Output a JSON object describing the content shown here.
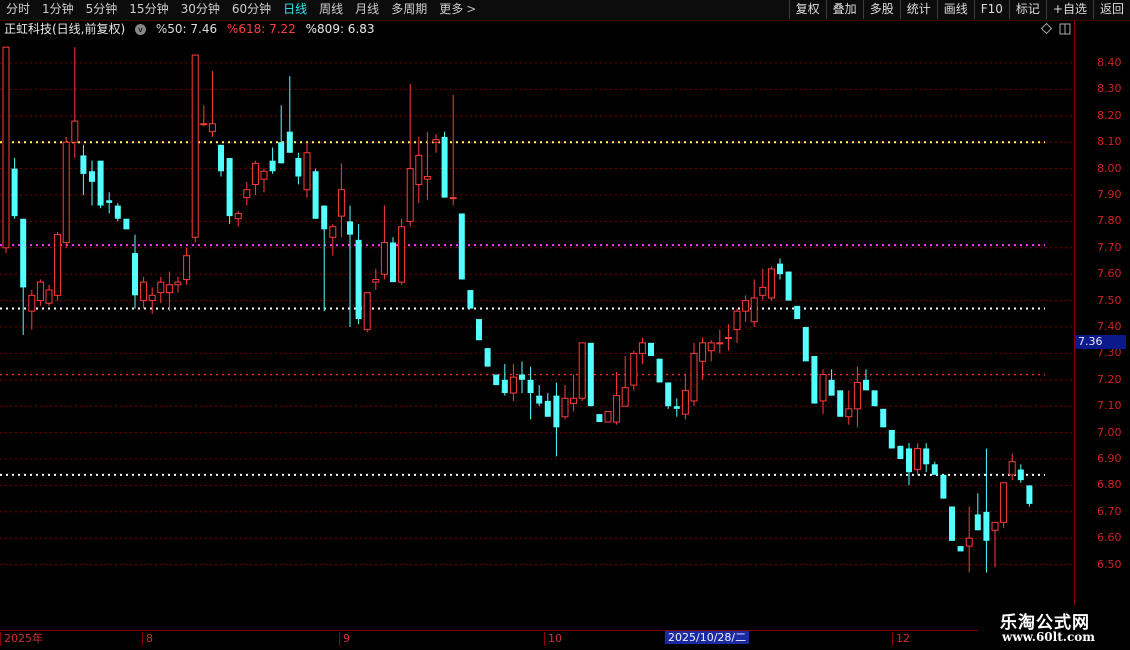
{
  "toolbar": {
    "tabs": [
      {
        "label": "分时",
        "active": false
      },
      {
        "label": "1分钟",
        "active": false
      },
      {
        "label": "5分钟",
        "active": false
      },
      {
        "label": "15分钟",
        "active": false
      },
      {
        "label": "30分钟",
        "active": false
      },
      {
        "label": "60分钟",
        "active": false
      },
      {
        "label": "日线",
        "active": true
      },
      {
        "label": "周线",
        "active": false
      },
      {
        "label": "月线",
        "active": false
      },
      {
        "label": "多周期",
        "active": false
      },
      {
        "label": "更多",
        "active": false
      }
    ],
    "right_buttons": [
      "复权",
      "叠加",
      "多股",
      "统计",
      "画线",
      "F10",
      "标记",
      "+自选",
      "返回"
    ]
  },
  "info": {
    "stock_name": "正虹科技(日线,前复权)",
    "ma50": "%50: 7.46",
    "ma618": "%618: 7.22",
    "ma809": "%809: 6.83"
  },
  "price_axis": {
    "labels": [
      "8.40",
      "8.30",
      "8.20",
      "8.10",
      "8.00",
      "7.90",
      "7.80",
      "7.70",
      "7.60",
      "7.50",
      "7.40",
      "7.30",
      "7.20",
      "7.10",
      "7.00",
      "6.90",
      "6.80",
      "6.70",
      "6.60",
      "6.50"
    ],
    "current_price": "7.36"
  },
  "time_axis": {
    "labels": [
      "2025年",
      "8",
      "9",
      "10",
      "12"
    ],
    "cursor_date": "2025/10/28/二"
  },
  "watermark": {
    "title": "乐淘公式网",
    "url": "www.60lt.com"
  },
  "colors": {
    "up": "#ff3b3b",
    "down": "#54ffff",
    "up_fill": "#000000",
    "level_yellow": "#ffff66",
    "level_magenta": "#ff33ff",
    "level_white": "#ffffff",
    "level_red": "#ff3030"
  },
  "chart_data": {
    "type": "candlestick",
    "y_range": [
      6.46,
      8.48
    ],
    "levels": [
      {
        "value": 8.1,
        "color": "yellow"
      },
      {
        "value": 7.71,
        "color": "magenta"
      },
      {
        "value": 7.47,
        "color": "white"
      },
      {
        "value": 7.22,
        "color": "red"
      },
      {
        "value": 6.84,
        "color": "white"
      }
    ],
    "candles": [
      [
        7.7,
        8.46,
        7.68,
        8.46
      ],
      [
        8.0,
        8.04,
        7.81,
        7.82
      ],
      [
        7.81,
        7.81,
        7.37,
        7.55
      ],
      [
        7.46,
        7.54,
        7.39,
        7.52
      ],
      [
        7.5,
        7.58,
        7.48,
        7.57
      ],
      [
        7.49,
        7.56,
        7.48,
        7.54
      ],
      [
        7.52,
        7.76,
        7.5,
        7.75
      ],
      [
        7.72,
        8.12,
        7.7,
        8.1
      ],
      [
        8.1,
        8.46,
        8.04,
        8.18
      ],
      [
        8.05,
        8.09,
        7.9,
        7.98
      ],
      [
        7.99,
        8.03,
        7.86,
        7.95
      ],
      [
        8.03,
        8.03,
        7.85,
        7.86
      ],
      [
        7.88,
        7.91,
        7.83,
        7.87
      ],
      [
        7.86,
        7.87,
        7.8,
        7.81
      ],
      [
        7.81,
        7.81,
        7.77,
        7.77
      ],
      [
        7.68,
        7.75,
        7.47,
        7.52
      ],
      [
        7.5,
        7.59,
        7.47,
        7.57
      ],
      [
        7.5,
        7.55,
        7.45,
        7.52
      ],
      [
        7.53,
        7.59,
        7.49,
        7.57
      ],
      [
        7.53,
        7.61,
        7.46,
        7.56
      ],
      [
        7.56,
        7.59,
        7.53,
        7.57
      ],
      [
        7.58,
        7.7,
        7.56,
        7.67
      ],
      [
        7.74,
        8.43,
        7.72,
        8.43
      ],
      [
        8.17,
        8.24,
        8.16,
        8.17
      ],
      [
        8.14,
        8.37,
        8.12,
        8.17
      ],
      [
        8.09,
        8.09,
        7.97,
        7.99
      ],
      [
        8.04,
        8.04,
        7.79,
        7.82
      ],
      [
        7.81,
        7.84,
        7.78,
        7.83
      ],
      [
        7.89,
        7.95,
        7.86,
        7.92
      ],
      [
        7.94,
        8.03,
        7.9,
        8.02
      ],
      [
        7.96,
        8.0,
        7.91,
        7.99
      ],
      [
        8.03,
        8.08,
        7.98,
        7.99
      ],
      [
        8.1,
        8.24,
        8.04,
        8.02
      ],
      [
        8.14,
        8.35,
        8.14,
        8.06
      ],
      [
        8.04,
        8.06,
        7.94,
        7.97
      ],
      [
        7.92,
        8.1,
        7.89,
        8.06
      ],
      [
        7.99,
        8.0,
        7.82,
        7.81
      ],
      [
        7.86,
        7.86,
        7.46,
        7.77
      ],
      [
        7.74,
        7.79,
        7.67,
        7.78
      ],
      [
        7.82,
        8.02,
        7.74,
        7.92
      ],
      [
        7.8,
        7.86,
        7.4,
        7.75
      ],
      [
        7.73,
        7.79,
        7.41,
        7.43
      ],
      [
        7.39,
        7.53,
        7.38,
        7.53
      ],
      [
        7.57,
        7.62,
        7.54,
        7.58
      ],
      [
        7.6,
        7.86,
        7.58,
        7.72
      ],
      [
        7.72,
        7.74,
        7.58,
        7.57
      ],
      [
        7.57,
        7.81,
        7.56,
        7.78
      ],
      [
        7.8,
        8.32,
        7.78,
        8.0
      ],
      [
        7.94,
        8.12,
        7.87,
        8.05
      ],
      [
        7.96,
        8.14,
        7.88,
        7.97
      ],
      [
        8.1,
        8.13,
        8.06,
        8.11
      ],
      [
        8.12,
        8.14,
        7.9,
        7.89
      ],
      [
        7.89,
        8.28,
        7.86,
        7.89
      ],
      [
        7.83,
        7.83,
        7.58,
        7.58
      ],
      [
        7.54,
        7.54,
        7.47,
        7.47
      ],
      [
        7.43,
        7.43,
        7.35,
        7.35
      ],
      [
        7.32,
        7.32,
        7.25,
        7.25
      ],
      [
        7.22,
        7.22,
        7.2,
        7.18
      ],
      [
        7.2,
        7.26,
        7.14,
        7.15
      ],
      [
        7.15,
        7.26,
        7.12,
        7.21
      ],
      [
        7.22,
        7.27,
        7.15,
        7.2
      ],
      [
        7.2,
        7.25,
        7.05,
        7.15
      ],
      [
        7.14,
        7.18,
        7.1,
        7.11
      ],
      [
        7.12,
        7.15,
        7.06,
        7.06
      ],
      [
        7.14,
        7.19,
        6.91,
        7.02
      ],
      [
        7.06,
        7.18,
        7.05,
        7.13
      ],
      [
        7.11,
        7.22,
        7.08,
        7.13
      ],
      [
        7.13,
        7.32,
        7.12,
        7.34
      ],
      [
        7.34,
        7.32,
        7.1,
        7.1
      ],
      [
        7.07,
        7.07,
        7.04,
        7.04
      ],
      [
        7.04,
        7.08,
        7.04,
        7.08
      ],
      [
        7.04,
        7.23,
        7.03,
        7.14
      ],
      [
        7.1,
        7.29,
        7.1,
        7.17
      ],
      [
        7.18,
        7.31,
        7.16,
        7.3
      ],
      [
        7.3,
        7.36,
        7.26,
        7.34
      ],
      [
        7.34,
        7.33,
        7.29,
        7.29
      ],
      [
        7.28,
        7.27,
        7.19,
        7.19
      ],
      [
        7.19,
        7.15,
        7.09,
        7.1
      ],
      [
        7.1,
        7.13,
        7.06,
        7.09
      ],
      [
        7.07,
        7.22,
        7.05,
        7.16
      ],
      [
        7.12,
        7.34,
        7.1,
        7.3
      ],
      [
        7.27,
        7.36,
        7.2,
        7.34
      ],
      [
        7.31,
        7.35,
        7.27,
        7.34
      ],
      [
        7.34,
        7.39,
        7.3,
        7.34
      ],
      [
        7.36,
        7.41,
        7.31,
        7.36
      ],
      [
        7.39,
        7.47,
        7.34,
        7.46
      ],
      [
        7.46,
        7.52,
        7.42,
        7.5
      ],
      [
        7.42,
        7.58,
        7.4,
        7.51
      ],
      [
        7.52,
        7.62,
        7.5,
        7.55
      ],
      [
        7.51,
        7.63,
        7.5,
        7.62
      ],
      [
        7.64,
        7.66,
        7.58,
        7.6
      ],
      [
        7.61,
        7.61,
        7.5,
        7.5
      ],
      [
        7.48,
        7.48,
        7.43,
        7.43
      ],
      [
        7.4,
        7.4,
        7.27,
        7.27
      ],
      [
        7.29,
        7.29,
        7.11,
        7.11
      ],
      [
        7.12,
        7.24,
        7.07,
        7.22
      ],
      [
        7.2,
        7.24,
        7.14,
        7.14
      ],
      [
        7.16,
        7.16,
        7.06,
        7.06
      ],
      [
        7.06,
        7.16,
        7.03,
        7.09
      ],
      [
        7.09,
        7.25,
        7.02,
        7.19
      ],
      [
        7.2,
        7.24,
        7.16,
        7.16
      ],
      [
        7.16,
        7.16,
        7.1,
        7.1
      ],
      [
        7.09,
        7.09,
        7.02,
        7.02
      ],
      [
        7.01,
        7.01,
        6.94,
        6.94
      ],
      [
        6.95,
        6.95,
        6.9,
        6.9
      ],
      [
        6.94,
        6.96,
        6.8,
        6.85
      ],
      [
        6.86,
        6.96,
        6.84,
        6.94
      ],
      [
        6.94,
        6.96,
        6.85,
        6.88
      ],
      [
        6.88,
        6.89,
        6.84,
        6.84
      ],
      [
        6.84,
        6.83,
        6.75,
        6.75
      ],
      [
        6.72,
        6.72,
        6.59,
        6.59
      ],
      [
        6.57,
        6.57,
        6.55,
        6.55
      ],
      [
        6.57,
        6.72,
        6.47,
        6.6
      ],
      [
        6.69,
        6.77,
        6.63,
        6.63
      ],
      [
        6.7,
        6.94,
        6.47,
        6.59
      ],
      [
        6.63,
        6.66,
        6.49,
        6.66
      ],
      [
        6.66,
        6.76,
        6.64,
        6.81
      ],
      [
        6.84,
        6.92,
        6.82,
        6.89
      ],
      [
        6.86,
        6.88,
        6.81,
        6.82
      ],
      [
        6.8,
        6.8,
        6.72,
        6.73
      ]
    ]
  }
}
